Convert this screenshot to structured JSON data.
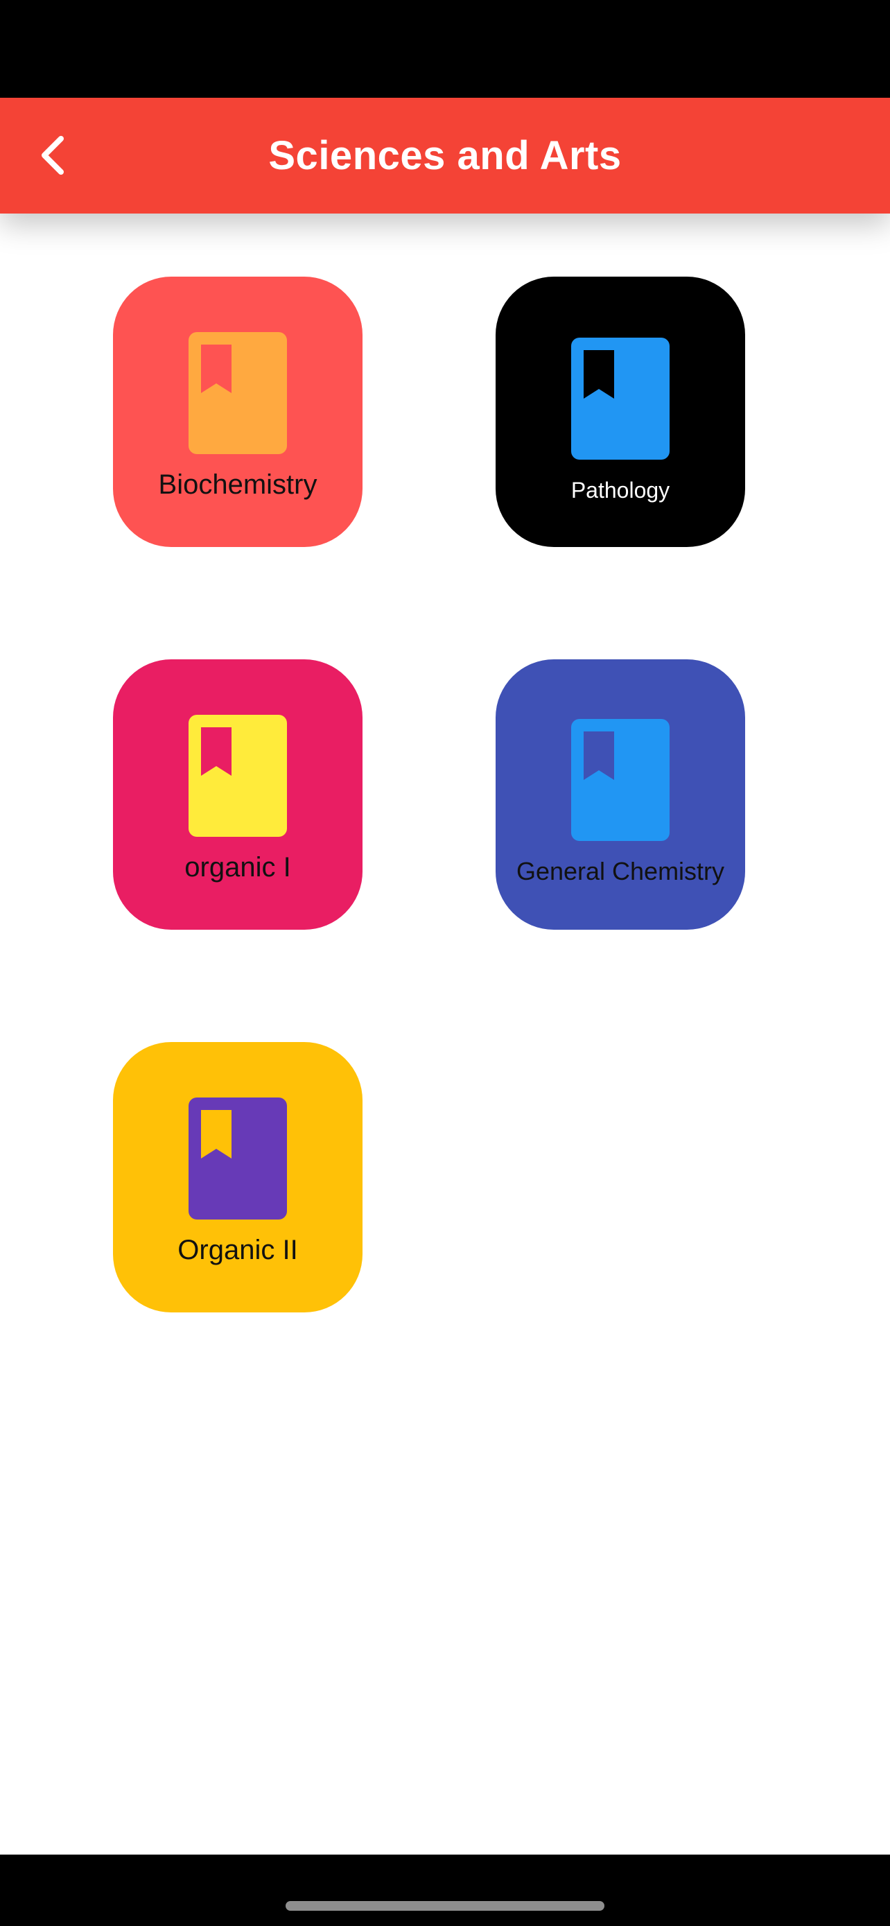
{
  "header": {
    "title": "Sciences and Arts",
    "back_icon": "chevron-left-icon",
    "background": "#f44336",
    "text_color": "#ffffff"
  },
  "tiles": [
    {
      "label": "Biochemistry",
      "tile_color": "#fe5352",
      "icon": "bookmark-book-icon",
      "icon_color": "#ffa940",
      "bookmark_color": "#fe5352",
      "label_color": "#111111"
    },
    {
      "label": "Pathology",
      "tile_color": "#000000",
      "icon": "bookmark-book-icon",
      "icon_color": "#2196f3",
      "bookmark_color": "#000000",
      "label_color": "#ffffff"
    },
    {
      "label": "organic I",
      "tile_color": "#e91e63",
      "icon": "bookmark-book-icon",
      "icon_color": "#ffeb3b",
      "bookmark_color": "#e91e63",
      "label_color": "#111111"
    },
    {
      "label": "General Chemistry",
      "tile_color": "#3f51b5",
      "icon": "bookmark-book-icon",
      "icon_color": "#2196f3",
      "bookmark_color": "#3f51b5",
      "label_color": "#111111"
    },
    {
      "label": "Organic II",
      "tile_color": "#ffc107",
      "icon": "bookmark-book-icon",
      "icon_color": "#673ab7",
      "bookmark_color": "#ffc107",
      "label_color": "#111111"
    }
  ]
}
